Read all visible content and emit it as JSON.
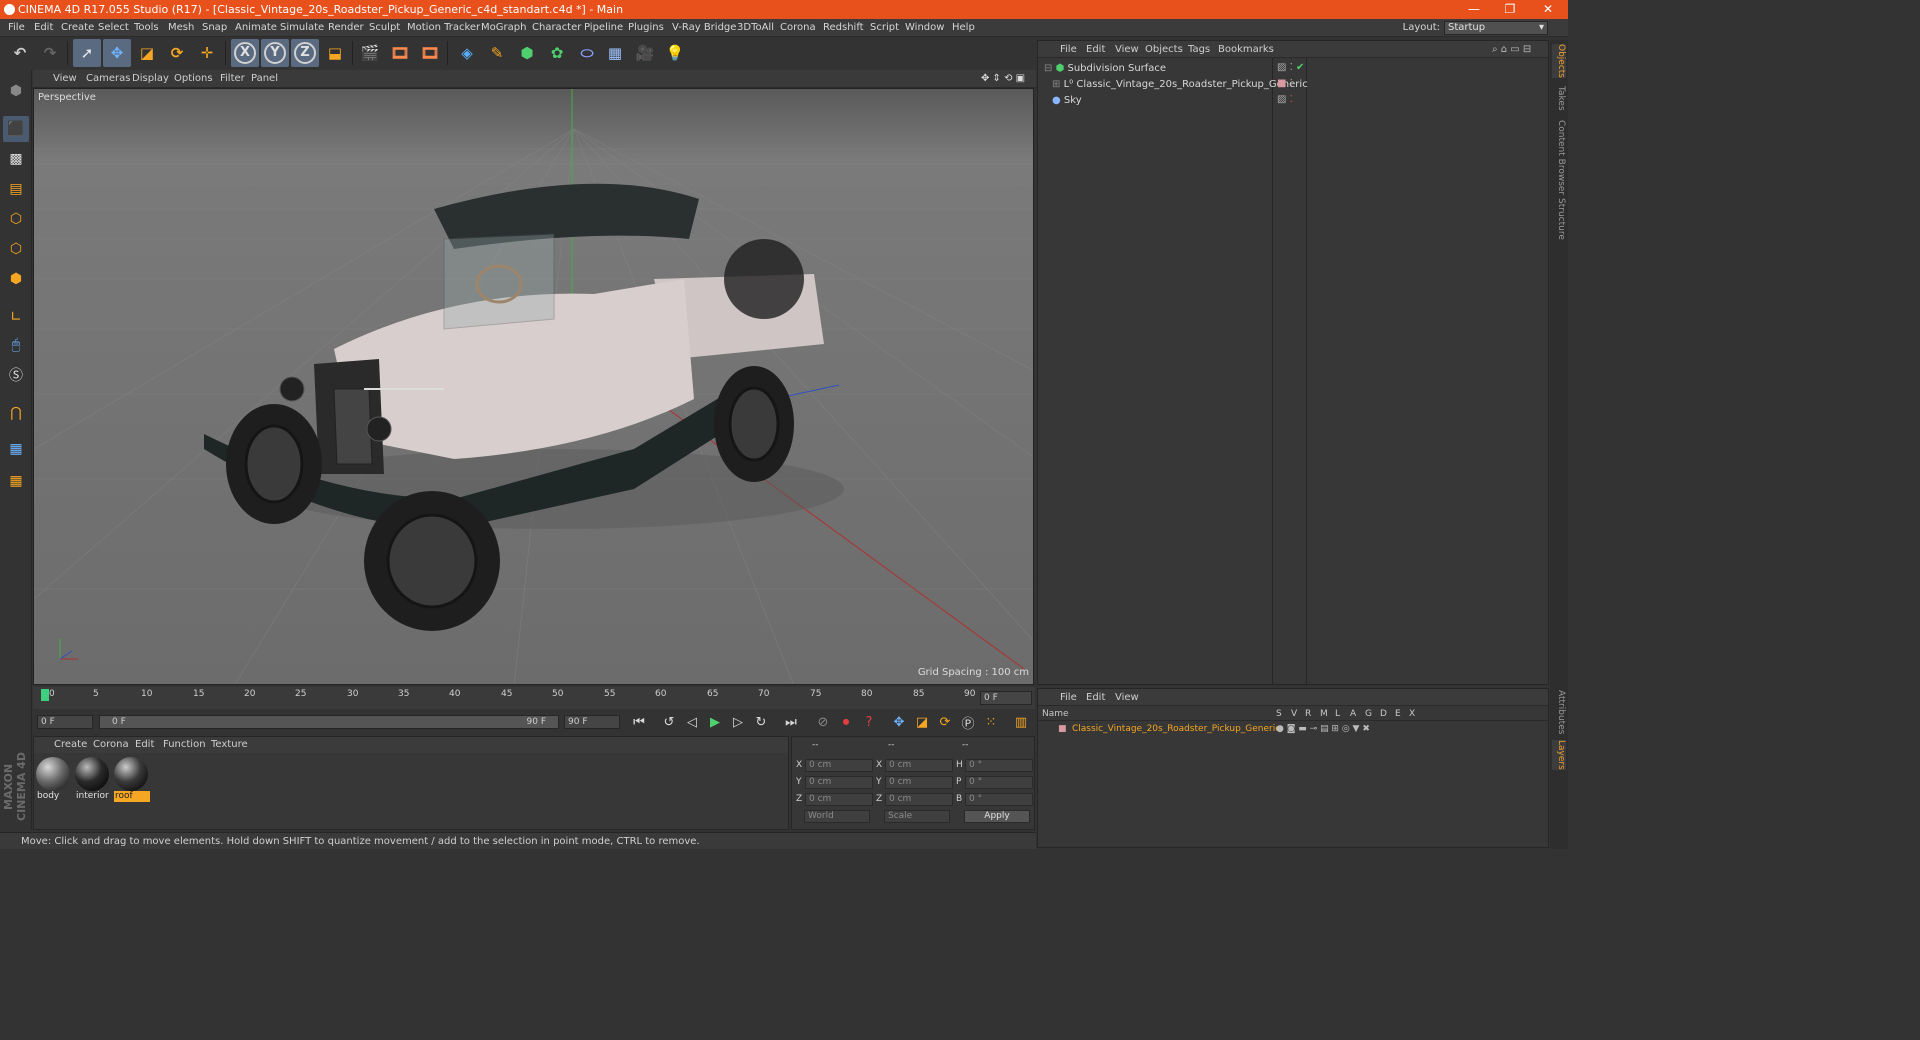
{
  "title": "CINEMA 4D R17.055 Studio (R17) - [Classic_Vintage_20s_Roadster_Pickup_Generic_c4d_standart.c4d *] - Main",
  "window_controls": {
    "minimize": "—",
    "restore": "❐",
    "close": "✕"
  },
  "menu": [
    "File",
    "Edit",
    "Create",
    "Select",
    "Tools",
    "Mesh",
    "Snap",
    "Animate",
    "Simulate",
    "Render",
    "Sculpt",
    "Motion Tracker",
    "MoGraph",
    "Character",
    "Pipeline",
    "Plugins",
    "V-Ray Bridge",
    "3DToAll",
    "Corona",
    "Redshift",
    "Script",
    "Window",
    "Help"
  ],
  "layout": {
    "label": "Layout:",
    "value": "Startup"
  },
  "toolbar": {
    "axis_x": "X",
    "axis_y": "Y",
    "axis_z": "Z"
  },
  "viewport": {
    "menu": [
      "View",
      "Cameras",
      "Display",
      "Options",
      "Filter",
      "Panel"
    ],
    "label": "Perspective",
    "grid_spacing": "Grid Spacing : 100 cm"
  },
  "objects_panel": {
    "menu": [
      "File",
      "Edit",
      "View",
      "Objects",
      "Tags",
      "Bookmarks"
    ],
    "items": [
      {
        "name": "Subdivision Surface",
        "indent": 0
      },
      {
        "name": "Classic_Vintage_20s_Roadster_Pickup_Generic",
        "indent": 1
      },
      {
        "name": "Sky",
        "indent": 0
      }
    ]
  },
  "side_tabs": [
    "Objects",
    "Takes",
    "Content Browser",
    "Structure"
  ],
  "side_tabs_lower": [
    "Attributes",
    "Layers"
  ],
  "timeline": {
    "ticks": [
      "0",
      "5",
      "10",
      "15",
      "20",
      "25",
      "30",
      "35",
      "40",
      "45",
      "50",
      "55",
      "60",
      "65",
      "70",
      "75",
      "80",
      "85",
      "90"
    ],
    "current_frame": "0 F",
    "start_field": "0 F",
    "range_start": "0 F",
    "range_end": "90 F",
    "end_field": "90 F"
  },
  "materials": {
    "menu": [
      "Create",
      "Corona",
      "Edit",
      "Function",
      "Texture"
    ],
    "items": [
      {
        "name": "body",
        "selected": false,
        "color": "#8a8a8a"
      },
      {
        "name": "interior",
        "selected": false,
        "color": "#2a2a2a"
      },
      {
        "name": "roof",
        "selected": true,
        "color": "#3a3a3a"
      }
    ]
  },
  "coordinates": {
    "headers": [
      "--",
      "--",
      "--"
    ],
    "rows": [
      {
        "a": "X",
        "a_val": "0 cm",
        "b": "X",
        "b_val": "0 cm",
        "c": "H",
        "c_val": "0 °"
      },
      {
        "a": "Y",
        "a_val": "0 cm",
        "b": "Y",
        "b_val": "0 cm",
        "c": "P",
        "c_val": "0 °"
      },
      {
        "a": "Z",
        "a_val": "0 cm",
        "b": "Z",
        "b_val": "0 cm",
        "c": "B",
        "c_val": "0 °"
      }
    ],
    "mode1": "World",
    "mode2": "Scale",
    "apply": "Apply"
  },
  "layers_panel": {
    "menu": [
      "File",
      "Edit",
      "View"
    ],
    "name_header": "Name",
    "columns": [
      "S",
      "V",
      "R",
      "M",
      "L",
      "A",
      "G",
      "D",
      "E",
      "X"
    ],
    "layer_name": "Classic_Vintage_20s_Roadster_Pickup_Generic"
  },
  "status": "Move: Click and drag to move elements. Hold down SHIFT to quantize movement / add to the selection in point mode, CTRL to remove.",
  "logo": "MAXON CINEMA 4D",
  "colors": {
    "accent": "#e8501c",
    "selection": "#f0a030",
    "active_material": "#f5a623"
  }
}
